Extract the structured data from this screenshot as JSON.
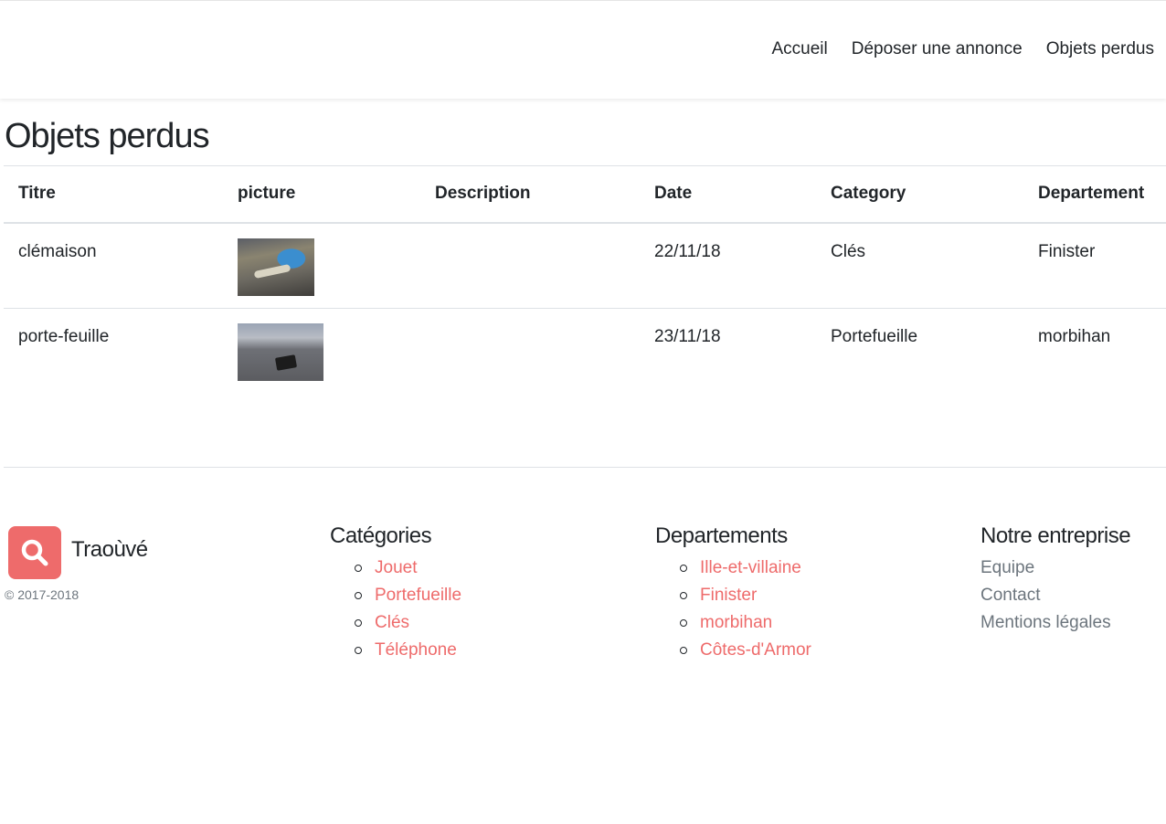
{
  "nav": {
    "links": [
      "Accueil",
      "Déposer une annonce",
      "Objets perdus"
    ]
  },
  "page": {
    "title": "Objets perdus"
  },
  "table": {
    "headers": [
      "Titre",
      "picture",
      "Description",
      "Date",
      "Category",
      "Departement"
    ],
    "rows": [
      {
        "titre": "clémaison",
        "picture": "keys-photo",
        "description": "",
        "date": "22/11/18",
        "category": "Clés",
        "departement": "Finister"
      },
      {
        "titre": "porte-feuille",
        "picture": "wallet-photo",
        "description": "",
        "date": "23/11/18",
        "category": "Portefueille",
        "departement": "morbihan"
      }
    ]
  },
  "footer": {
    "brand": {
      "name": "Traoùvé",
      "icon": "search-icon",
      "copyright": "© 2017-2018"
    },
    "categories": {
      "heading": "Catégories",
      "items": [
        "Jouet",
        "Portefueille",
        "Clés",
        "Téléphone"
      ]
    },
    "departements": {
      "heading": "Departements",
      "items": [
        "Ille-et-villaine",
        "Finister",
        "morbihan",
        "Côtes-d'Armor"
      ]
    },
    "entreprise": {
      "heading": "Notre entreprise",
      "items": [
        "Equipe",
        "Contact",
        "Mentions légales"
      ]
    }
  },
  "colors": {
    "accent": "#ee6b6b",
    "text": "#212529",
    "muted": "#6c757d",
    "border": "#dee2e6"
  }
}
